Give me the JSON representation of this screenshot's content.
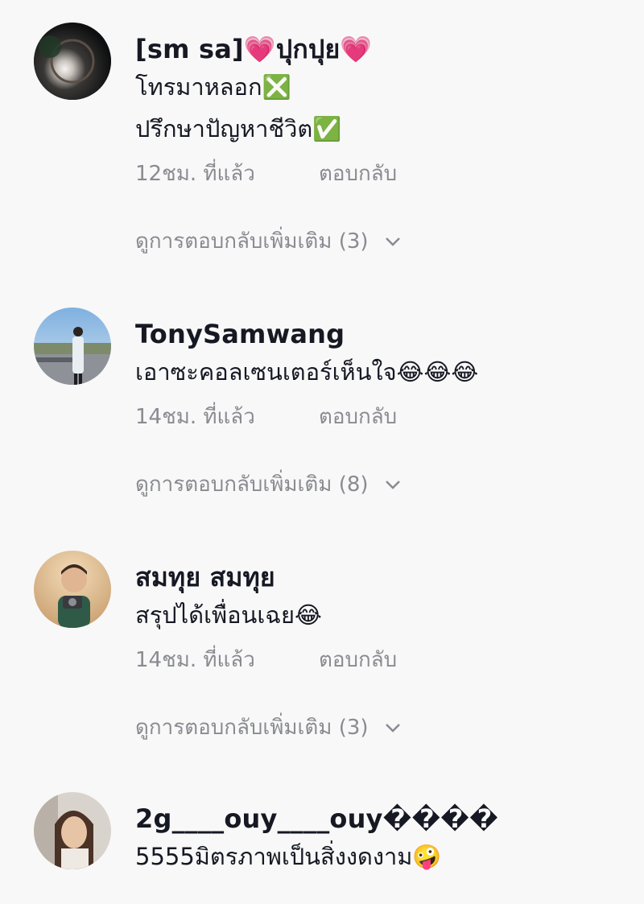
{
  "comments": [
    {
      "username": "[sm sa]💗ปุกปุย💗",
      "text": "โทรมาหลอก❎\nปรึกษาปัญหาชีวิต✅",
      "time": "12ชม. ที่แล้ว",
      "reply_label": "ตอบกลับ",
      "more_replies": "ดูการตอบกลับเพิ่มเติม (3)"
    },
    {
      "username": "TonySamwang",
      "text": "เอาซะคอลเซนเตอร์เห็นใจ😂😂😂",
      "time": "14ชม. ที่แล้ว",
      "reply_label": "ตอบกลับ",
      "more_replies": "ดูการตอบกลับเพิ่มเติม (8)"
    },
    {
      "username": "สมทุย สมทุย",
      "text": "สรุปได้เพื่อนเฉย😂",
      "time": "14ชม. ที่แล้ว",
      "reply_label": "ตอบกลับ",
      "more_replies": "ดูการตอบกลับเพิ่มเติม (3)"
    },
    {
      "username": "2g____ouy____ouy����",
      "text": "5555มิตรภาพเป็นสิ่งงดงาม🤪"
    }
  ],
  "colors": {
    "background": "#f8f8f8",
    "primary_text": "#161823",
    "secondary_text": "#8a8b91"
  },
  "icons": {
    "expand": "chevron-down-icon"
  }
}
